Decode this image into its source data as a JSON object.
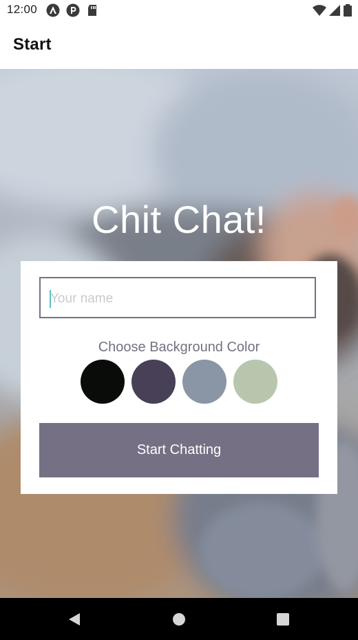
{
  "status_bar": {
    "time": "12:00",
    "left_icons": [
      "android-auto-icon",
      "p-badge-icon",
      "sd-card-icon"
    ],
    "right_icons": [
      "wifi-icon",
      "signal-icon",
      "battery-icon"
    ]
  },
  "app_bar": {
    "title": "Start"
  },
  "main": {
    "heading": "Chit Chat!",
    "name_input": {
      "placeholder": "Your name",
      "value": ""
    },
    "color_label": "Choose Background Color",
    "colors": [
      {
        "hex": "#090C08"
      },
      {
        "hex": "#474056"
      },
      {
        "hex": "#8A95A5"
      },
      {
        "hex": "#B9C6AE"
      }
    ],
    "start_button": "Start Chatting",
    "button_color": "#757083"
  },
  "nav_bar": {
    "buttons": [
      "back-icon",
      "home-icon",
      "recents-icon"
    ]
  }
}
